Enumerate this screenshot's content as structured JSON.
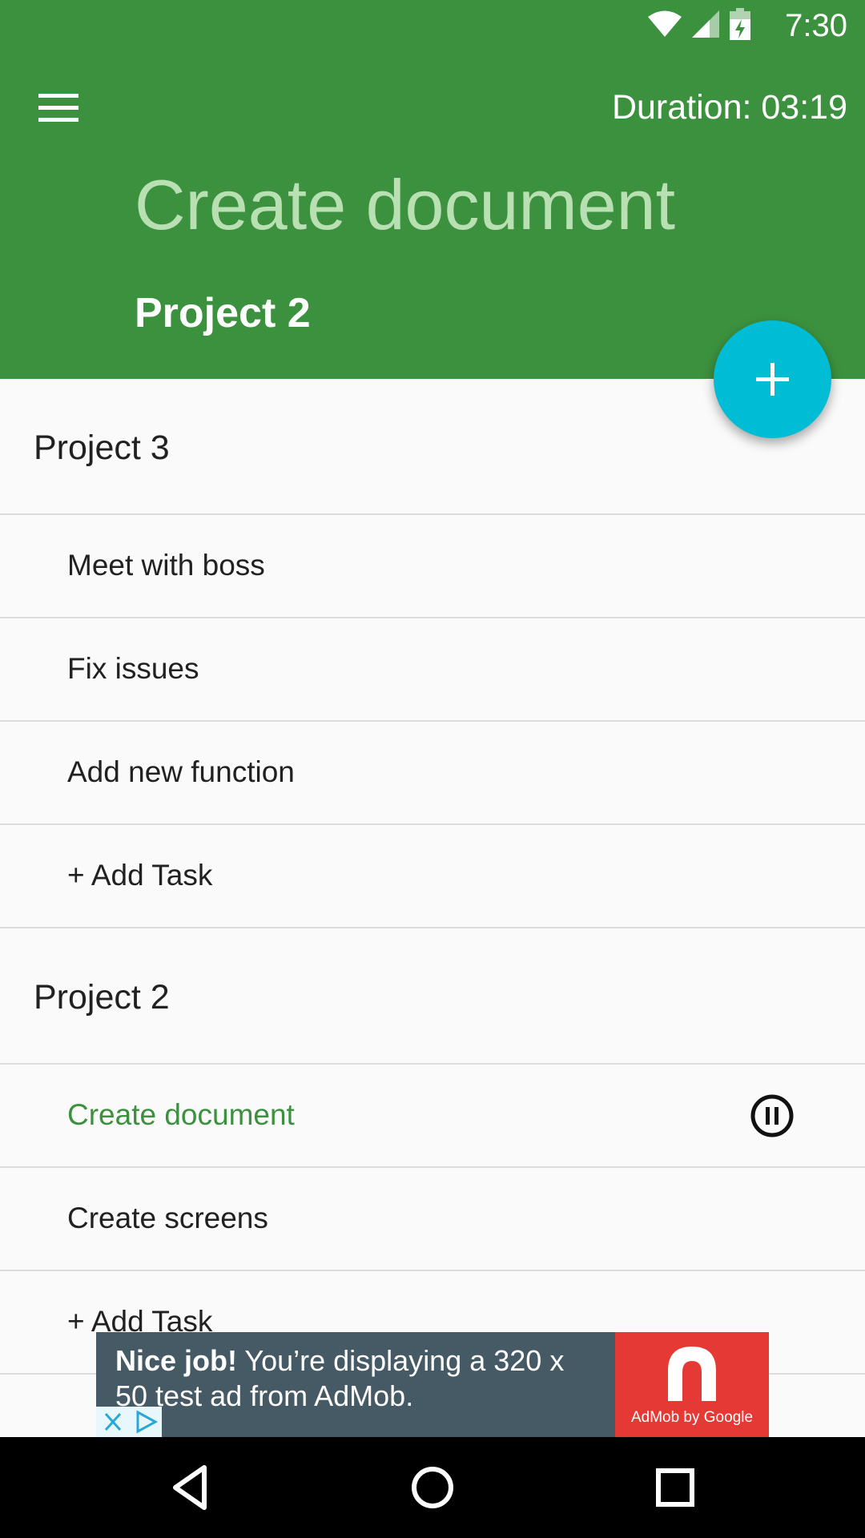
{
  "status_bar": {
    "time": "7:30",
    "icons": [
      "wifi-icon",
      "signal-icon",
      "battery-charging-icon"
    ]
  },
  "toolbar": {
    "menu_icon": "menu-icon",
    "duration": "Duration: 03:19"
  },
  "current_task": {
    "title": "Create document",
    "project": "Project 2"
  },
  "fab": {
    "icon": "plus-icon"
  },
  "list": {
    "project_3": {
      "name": "Project 3",
      "tasks": [
        "Meet with boss",
        "Fix issues",
        "Add new function"
      ],
      "add_task": "+ Add Task"
    },
    "project_2": {
      "name": "Project 2",
      "tasks": [
        "Create document",
        "Create screens"
      ],
      "add_task": "+ Add Task",
      "active_task_icon": "pause-icon"
    }
  },
  "ad": {
    "headline": "Nice job!",
    "text": " You’re displaying a 320 x 50 test ad from AdMob.",
    "logo_caption": "AdMob by Google"
  },
  "nav_bar": {
    "icons": [
      "back-icon",
      "home-icon",
      "recents-icon"
    ]
  },
  "colors": {
    "header": "#3c913e",
    "fab": "#00bcd4",
    "active_task": "#3c913e",
    "ad_background": "#455a64",
    "ad_logo": "#e53935"
  }
}
